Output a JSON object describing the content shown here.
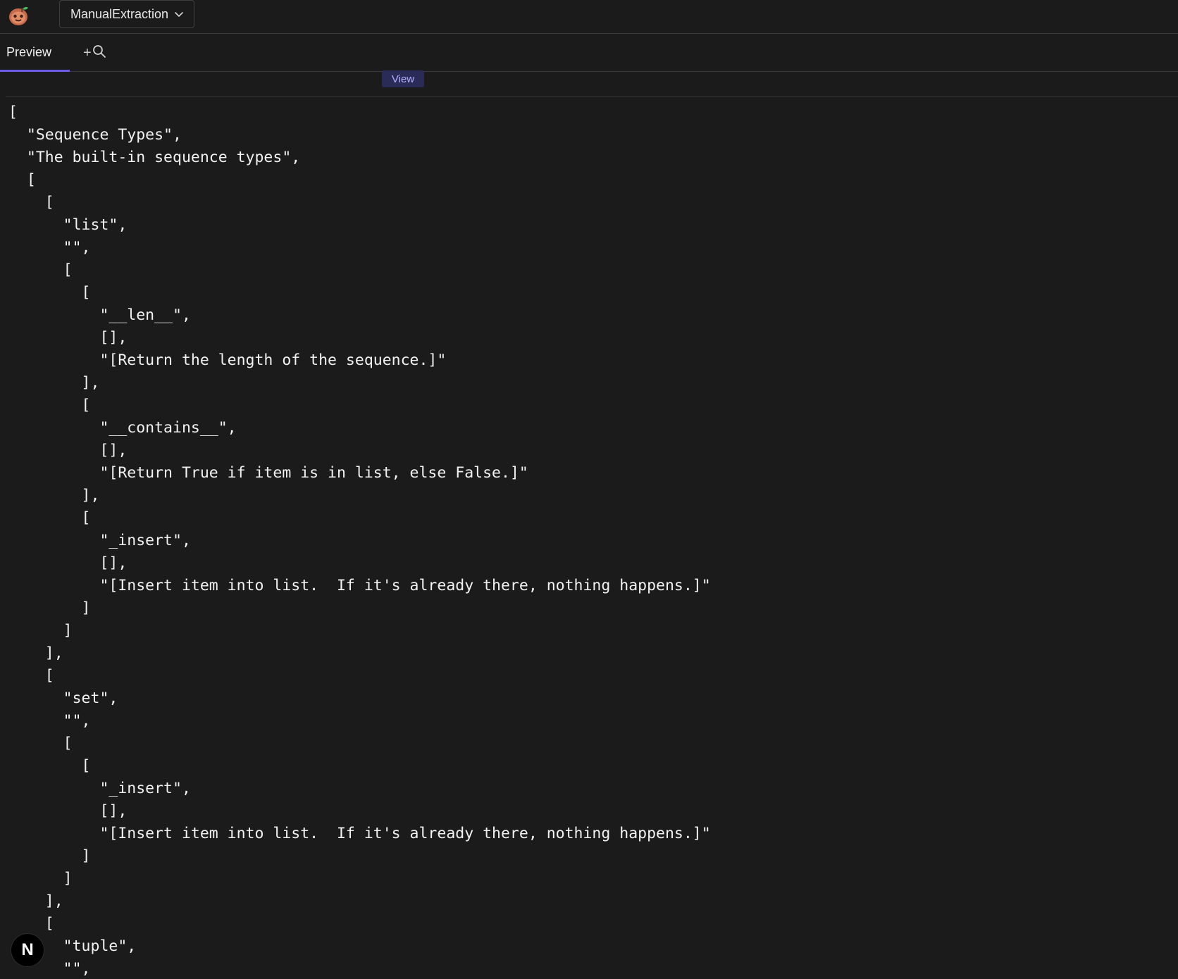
{
  "app": {
    "project_selector": {
      "label": "ManualExtraction"
    },
    "tabs": [
      {
        "label": "Preview",
        "active": true
      }
    ],
    "view_button": {
      "label": "View"
    },
    "avatar": {
      "initial": "N"
    }
  },
  "preview_output": {
    "json_text": "[\n  \"Sequence Types\",\n  \"The built-in sequence types\",\n  [\n    [\n      \"list\",\n      \"\",\n      [\n        [\n          \"__len__\",\n          [],\n          \"[Return the length of the sequence.]\"\n        ],\n        [\n          \"__contains__\",\n          [],\n          \"[Return True if item is in list, else False.]\"\n        ],\n        [\n          \"_insert\",\n          [],\n          \"[Insert item into list.  If it's already there, nothing happens.]\"\n        ]\n      ]\n    ],\n    [\n      \"set\",\n      \"\",\n      [\n        [\n          \"_insert\",\n          [],\n          \"[Insert item into list.  If it's already there, nothing happens.]\"\n        ]\n      ]\n    ],\n    [\n      \"tuple\",\n      \"\","
  },
  "icons": {
    "logo": "app-logo-icon",
    "chevron": "chevron-down-icon",
    "search": "search-icon",
    "plus": "plus-icon"
  },
  "colors": {
    "background": "#1b1b1c",
    "accent": "#6c5ce7",
    "view_button_bg": "#2b2b58",
    "view_button_text": "#b6b0ff",
    "text": "#f2f2f2",
    "border": "#3b3b3f"
  }
}
